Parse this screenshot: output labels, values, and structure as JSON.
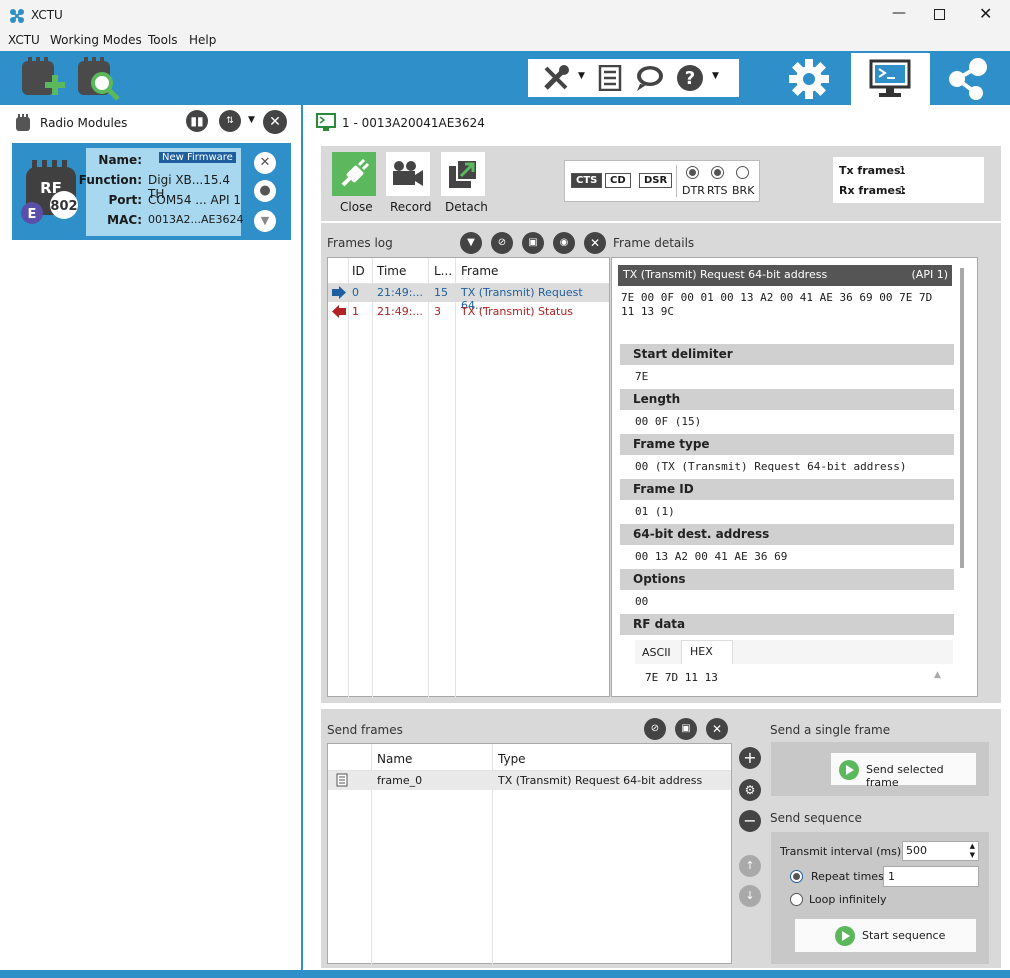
{
  "window": {
    "title": "XCTU"
  },
  "menu": [
    "XCTU",
    "Working Modes",
    "Tools",
    "Help"
  ],
  "toolbar": {
    "left_icons": [
      "add-module-icon",
      "discover-module-icon"
    ],
    "group_icons": [
      "tools-icon",
      "list-icon",
      "feedback-icon",
      "help-icon"
    ],
    "right_icons": [
      "gear-icon",
      "console-icon",
      "network-icon"
    ]
  },
  "radio_modules": {
    "title": "Radio Modules",
    "module": {
      "name_label": "Name:",
      "name_value": "New Firmware",
      "function_label": "Function:",
      "function_value": "Digi XB...15.4 TH",
      "port_label": "Port:",
      "port_value": "COM54 ... API 1",
      "mac_label": "MAC:",
      "mac_value": "0013A2...AE3624",
      "badge_letter": "E",
      "badge_num": "802",
      "chip_label": "RF"
    }
  },
  "console_tab": {
    "title": "1 - 0013A20041AE3624"
  },
  "controls": {
    "buttons": [
      "Close",
      "Record",
      "Detach"
    ],
    "indicators": [
      "CTS",
      "CD",
      "DSR"
    ],
    "lines": [
      "DTR",
      "RTS",
      "BRK"
    ],
    "tx_label": "Tx frames:",
    "tx_value": "1",
    "rx_label": "Rx frames:",
    "rx_value": "1"
  },
  "frames_log": {
    "title": "Frames log",
    "columns": [
      "ID",
      "Time",
      "L...",
      "Frame"
    ],
    "rows": [
      {
        "id": "0",
        "time": "21:49:...",
        "len": "15",
        "frame": "TX (Transmit) Request 64...",
        "dir": "out"
      },
      {
        "id": "1",
        "time": "21:49:...",
        "len": "3",
        "frame": "TX (Transmit) Status",
        "dir": "in"
      }
    ]
  },
  "frame_details": {
    "title": "Frame details",
    "header": "TX (Transmit) Request 64-bit address",
    "api": "(API 1)",
    "raw_line1": "7E 00 0F 00 01 00 13 A2 00 41 AE 36 69 00 7E 7D",
    "raw_line2": "11 13 9C",
    "fields": [
      {
        "label": "Start delimiter",
        "value": "7E"
      },
      {
        "label": "Length",
        "value": "00 0F (15)"
      },
      {
        "label": "Frame type",
        "value": "00 (TX (Transmit) Request 64-bit address)"
      },
      {
        "label": "Frame ID",
        "value": "01 (1)"
      },
      {
        "label": "64-bit dest. address",
        "value": "00 13 A2 00 41 AE 36 69"
      },
      {
        "label": "Options",
        "value": "00"
      }
    ],
    "rf_label": "RF data",
    "rf_tabs": [
      "ASCII",
      "HEX"
    ],
    "rf_value": "7E 7D 11 13"
  },
  "send_frames": {
    "title": "Send frames",
    "columns": [
      "Name",
      "Type"
    ],
    "rows": [
      {
        "name": "frame_0",
        "type": "TX (Transmit) Request 64-bit address"
      }
    ]
  },
  "single_frame": {
    "title": "Send a single frame",
    "button": "Send selected frame"
  },
  "sequence": {
    "title": "Send sequence",
    "interval_label": "Transmit interval (ms):",
    "interval_value": "500",
    "repeat_label": "Repeat times",
    "repeat_value": "1",
    "loop_label": "Loop infinitely",
    "button": "Start sequence"
  },
  "colors": {
    "accent": "#2e8fc9",
    "panel": "#d9d9d9",
    "in_frame": "#b22222",
    "out_frame": "#1f5f9f"
  }
}
